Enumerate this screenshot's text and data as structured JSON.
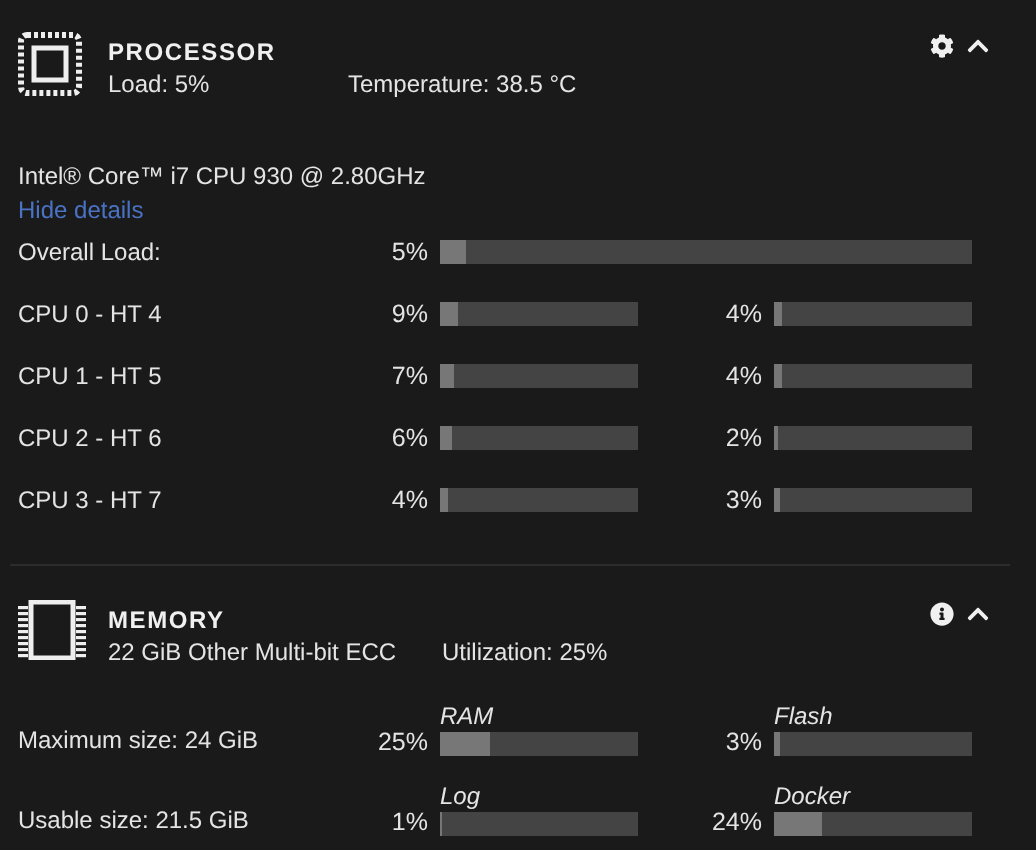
{
  "processor": {
    "title": "PROCESSOR",
    "expanded": true,
    "load": "Load: 5%",
    "temperature": "Temperature: 38.5 °C",
    "model": "Intel® Core™ i7 CPU 930 @ 2.80GHz",
    "details_link": "Hide details",
    "overall": {
      "label": "Overall Load:",
      "reading": "5%",
      "level": 0.05
    },
    "cpus": [
      {
        "label": "CPU 0 - HT 4",
        "threads": [
          {
            "reading": "9%",
            "level": 0.09
          },
          {
            "reading": "4%",
            "level": 0.04
          }
        ]
      },
      {
        "label": "CPU 1 - HT 5",
        "threads": [
          {
            "reading": "7%",
            "level": 0.07
          },
          {
            "reading": "4%",
            "level": 0.04
          }
        ]
      },
      {
        "label": "CPU 2 - HT 6",
        "threads": [
          {
            "reading": "6%",
            "level": 0.06
          },
          {
            "reading": "2%",
            "level": 0.02
          }
        ]
      },
      {
        "label": "CPU 3 - HT 7",
        "threads": [
          {
            "reading": "4%",
            "level": 0.04
          },
          {
            "reading": "3%",
            "level": 0.03
          }
        ]
      }
    ]
  },
  "memory": {
    "title": "MEMORY",
    "expanded": true,
    "summary": "22 GiB Other Multi-bit ECC",
    "utilization": "Utilization: 25%",
    "rows": [
      {
        "label": "Maximum size: 24 GiB",
        "gauges": [
          {
            "name": "RAM",
            "reading": "25%",
            "level": 0.25
          },
          {
            "name": "Flash",
            "reading": "3%",
            "level": 0.03
          }
        ]
      },
      {
        "label": "Usable size: 21.5 GiB",
        "gauges": [
          {
            "name": "Log",
            "reading": "1%",
            "level": 0.01
          },
          {
            "name": "Docker",
            "reading": "24%",
            "level": 0.24
          }
        ]
      }
    ]
  }
}
